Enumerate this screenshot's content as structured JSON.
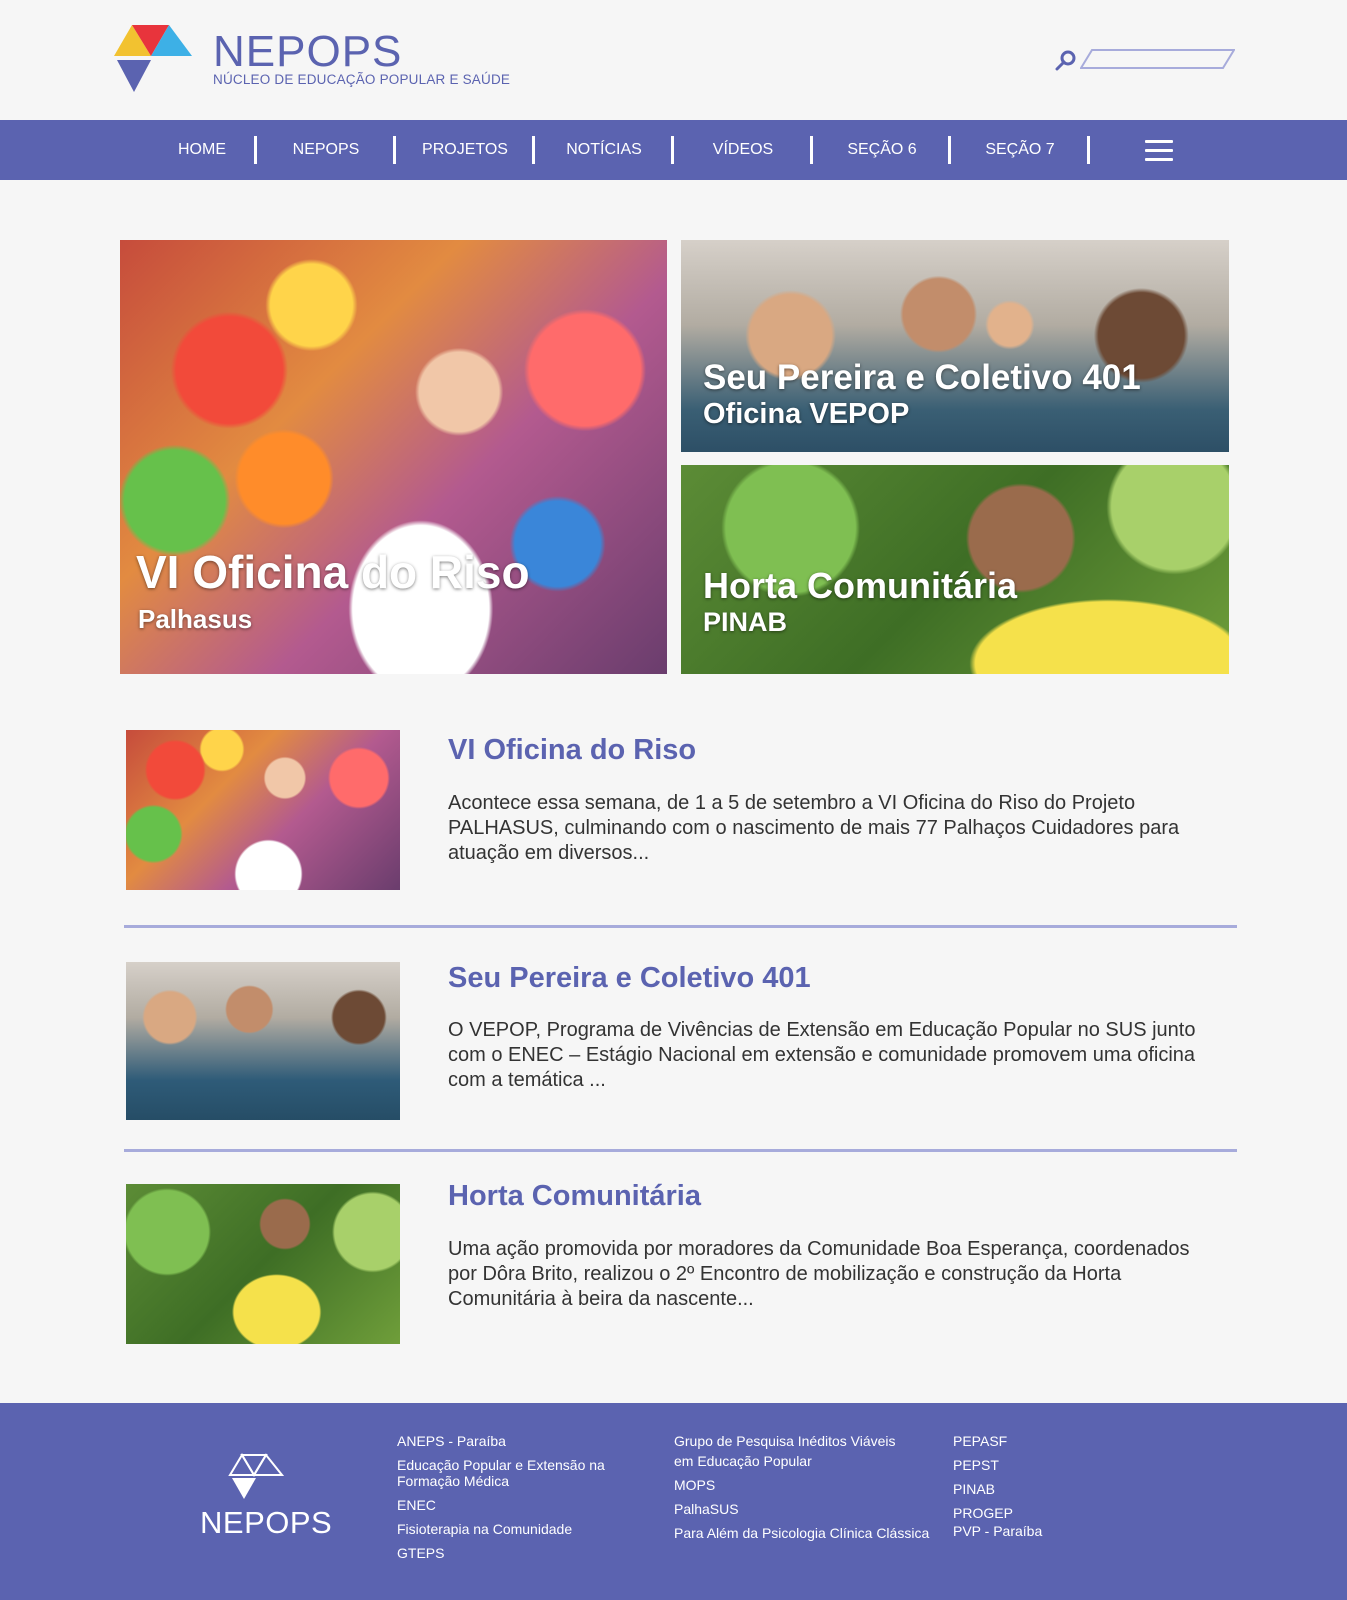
{
  "header": {
    "brand_name": "NEPOPS",
    "brand_subtitle": "NÚCLEO DE EDUCAÇÃO POPULAR E SAÚDE",
    "search_placeholder": ""
  },
  "nav": {
    "items": [
      "HOME",
      "NEPOPS",
      "PROJETOS",
      "NOTÍCIAS",
      "VÍDEOS",
      "SEÇÃO 6",
      "SEÇÃO 7"
    ]
  },
  "hero": {
    "main": {
      "title": "VI Oficina do Riso",
      "subtitle": "Palhasus"
    },
    "top_right": {
      "title": "Seu Pereira e Coletivo 401",
      "subtitle": "Oficina VEPOP"
    },
    "bottom_right": {
      "title": "Horta Comunitária",
      "subtitle": "PINAB"
    }
  },
  "articles": [
    {
      "title": "VI Oficina do Riso",
      "lines": [
        "Acontece essa semana, de 1 a 5 de setembro a VI Oficina do Riso do Projeto",
        "PALHASUS, culminando com o nascimento de mais 77 Palhaços Cuidadores para",
        "atuação  em diversos..."
      ]
    },
    {
      "title": "Seu Pereira e Coletivo 401",
      "lines": [
        "O VEPOP, Programa de Vivências de Extensão em Educação Popular no SUS junto",
        "com o ENEC – Estágio Nacional em extensão e comunidade promovem uma oficina",
        "com a temática ..."
      ]
    },
    {
      "title": "Horta Comunitária",
      "lines": [
        "Uma ação promovida por moradores da Comunidade Boa Esperança, coordenados",
        "por Dôra Brito, realizou  o 2º Encontro de mobilização e construção da Horta",
        "Comunitária à beira da nascente..."
      ]
    }
  ],
  "footer": {
    "brand_name": "NEPOPS",
    "col1": [
      "ANEPS - Paraíba",
      "Educação Popular e Extensão na",
      "Formação Médica",
      "ENEC",
      "Fisioterapia na Comunidade",
      "GTEPS"
    ],
    "col2": [
      "Grupo de Pesquisa Inéditos Viáveis",
      "em Educação Popular",
      "MOPS",
      "PalhaSUS",
      "Para Além da Psicologia Clínica Clássica"
    ],
    "col3": [
      "PEPASF",
      "PEPST",
      "PINAB",
      "PROGEP",
      "PVP - Paraíba"
    ]
  },
  "colors": {
    "primary": "#5b63b0",
    "divider": "#a7abdb",
    "background": "#f6f6f6",
    "logo_red": "#e8343c",
    "logo_yellow": "#f2c230",
    "logo_cyan": "#3db0e6",
    "logo_purple": "#5b63b0"
  }
}
